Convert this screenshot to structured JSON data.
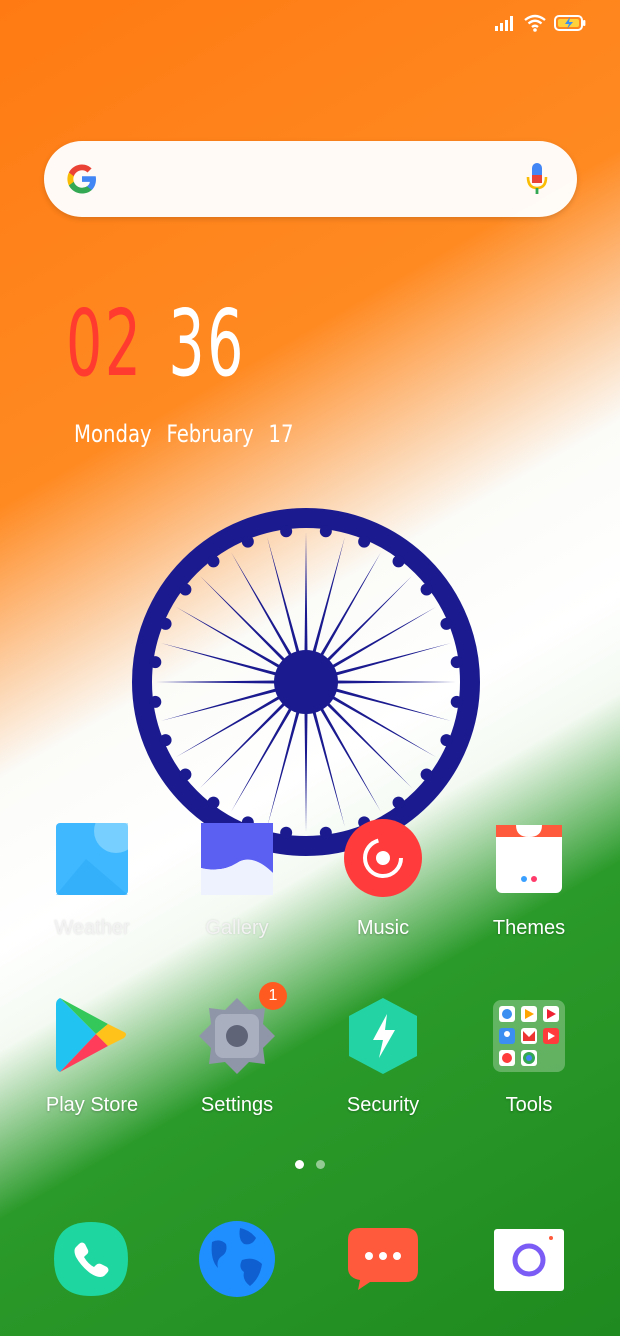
{
  "status": {
    "icons": [
      "signal-icon",
      "wifi-icon",
      "battery-charging-icon"
    ]
  },
  "search": {
    "placeholder": "",
    "google_icon": "google-g-icon",
    "mic_icon": "microphone-icon"
  },
  "clock": {
    "hours": "02",
    "minutes": "36"
  },
  "date": {
    "weekday": "Monday",
    "month": "February",
    "day": "17"
  },
  "wallpaper": {
    "theme": "tricolour-flag",
    "saffron": "#ff7a12",
    "white": "#ffffff",
    "green": "#1f8a1f",
    "chakra_blue": "#1b1b8f"
  },
  "apps_row1": [
    {
      "label": "Weather",
      "icon": "weather-icon"
    },
    {
      "label": "Gallery",
      "icon": "gallery-icon"
    },
    {
      "label": "Music",
      "icon": "music-icon"
    },
    {
      "label": "Themes",
      "icon": "themes-icon"
    }
  ],
  "apps_row2": [
    {
      "label": "Play Store",
      "icon": "play-store-icon"
    },
    {
      "label": "Settings",
      "icon": "settings-icon",
      "badge": "1"
    },
    {
      "label": "Security",
      "icon": "security-icon"
    },
    {
      "label": "Tools",
      "icon": "tools-folder-icon"
    }
  ],
  "pager": {
    "pages": 2,
    "current": 1
  },
  "dock": [
    {
      "icon": "phone-icon"
    },
    {
      "icon": "browser-icon"
    },
    {
      "icon": "messaging-icon"
    },
    {
      "icon": "camera-icon"
    }
  ]
}
